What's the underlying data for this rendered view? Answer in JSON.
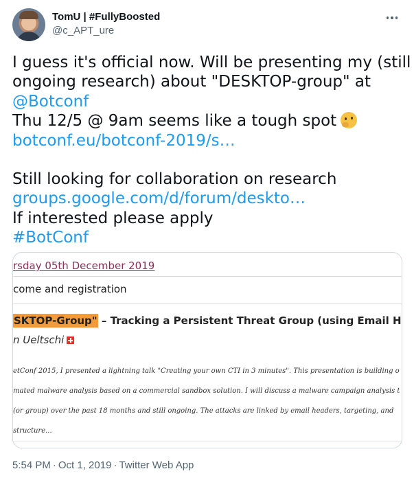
{
  "user": {
    "display_name": "TomU | #FullyBoosted",
    "handle": "@c_APT_ure"
  },
  "tweet": {
    "line1": "I guess it's official now. Will be presenting my (still",
    "line2": "ongoing research) about \"DESKTOP-group\" at",
    "mention": "@Botconf",
    "line4": "Thu 12/5 @ 9am seems like a tough spot",
    "emoji": "thinking-face",
    "link1": "botconf.eu/botconf-2019/s…",
    "line6": "Still looking for collaboration on research",
    "link2": "groups.google.com/d/forum/deskto…",
    "line8": "If interested please apply",
    "hashtag": "#BotConf"
  },
  "card": {
    "date": "rsday 05th December 2019",
    "welcome": "come and registration",
    "title_highlight": "SKTOP-Group\"",
    "title_rest": " – Tracking a Persistent Threat Group (using Email Headers)",
    "speaker": "n Ueltschi",
    "abstract": [
      "etConf 2015, I presented a lightning talk \"Creating your own CTI in 3 minutes\". This presentation is building o",
      "mated malware analysis based on a commercial sandbox solution. I will discuss a malware campaign analysis t",
      "(or group) over the past 18 months and still ongoing. The attacks are linked by email headers, targeting, and",
      "structure..."
    ]
  },
  "meta": {
    "time": "5:54 PM",
    "date": "Oct 1, 2019",
    "source": "Twitter Web App",
    "separator": "·"
  },
  "colors": {
    "link": "#1d9bf0",
    "secondary_text": "#536471",
    "highlight": "#f39a3a",
    "date_color": "#8b2f55"
  }
}
